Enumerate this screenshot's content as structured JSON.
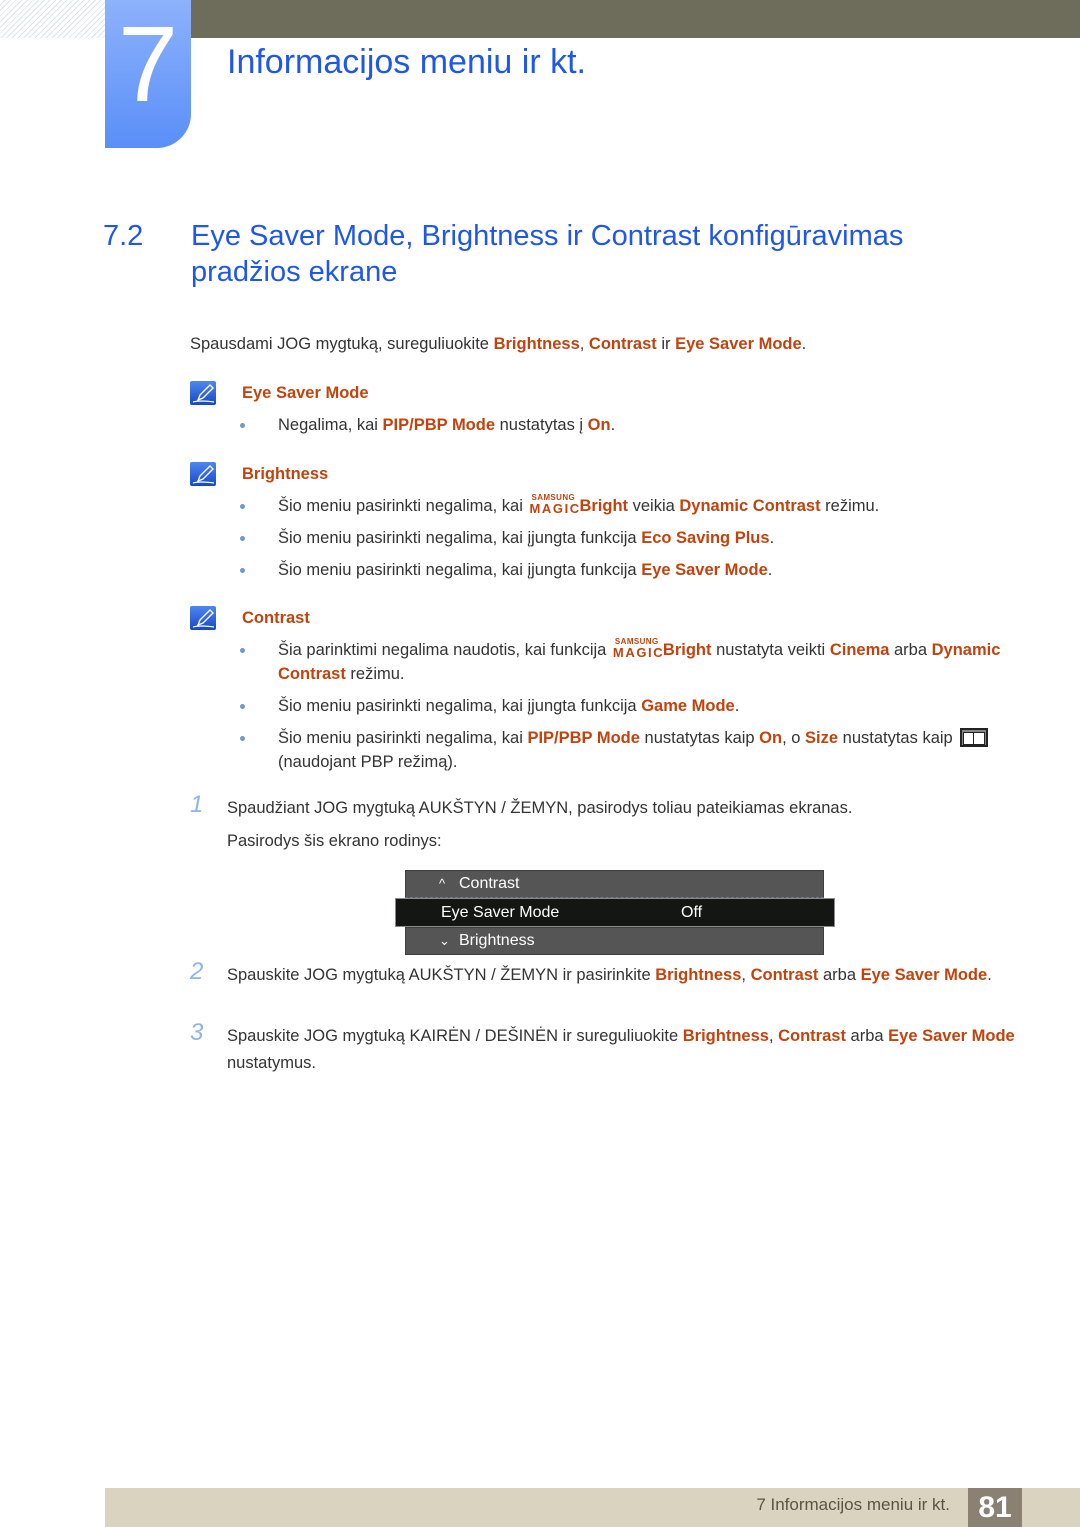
{
  "header": {
    "chapter_number": "7",
    "chapter_title": "Informacijos meniu ir kt."
  },
  "section": {
    "number": "7.2",
    "title": "Eye Saver Mode, Brightness ir Contrast konfigūravimas pradžios ekrane"
  },
  "intro": {
    "t1": "Spausdami JOG mygtuką, sureguliuokite ",
    "h1": "Brightness",
    "t2": ", ",
    "h2": "Contrast",
    "t3": " ir ",
    "h3": "Eye Saver Mode",
    "t4": "."
  },
  "notes": [
    {
      "title": "Eye Saver Mode",
      "bullets": [
        {
          "t1": "Negalima, kai ",
          "h1": "PIP/PBP Mode",
          "t2": " nustatytas į ",
          "h2": "On",
          "t3": "."
        }
      ]
    },
    {
      "title": "Brightness",
      "bullets": [
        {
          "t1": "Šio meniu pasirinkti negalima, kai ",
          "logo_top": "SAMSUNG",
          "logo_bottom": "MAGIC",
          "h1": "Bright",
          "t2": " veikia ",
          "h2": "Dynamic Contrast",
          "t3": " režimu."
        },
        {
          "t1": "Šio meniu pasirinkti negalima, kai įjungta funkcija ",
          "h1": "Eco Saving Plus",
          "t2": "."
        },
        {
          "t1": "Šio meniu pasirinkti negalima, kai įjungta funkcija ",
          "h1": "Eye Saver Mode",
          "t2": "."
        }
      ]
    },
    {
      "title": "Contrast",
      "bullets": [
        {
          "t1": "Šia parinktimi negalima naudotis, kai funkcija ",
          "logo_top": "SAMSUNG",
          "logo_bottom": "MAGIC",
          "h1": "Bright",
          "t2": " nustatyta veikti ",
          "h2": "Cinema",
          "t3": " arba ",
          "h3": "Dynamic Contrast",
          "t4": " režimu."
        },
        {
          "t1": "Šio meniu pasirinkti negalima, kai įjungta funkcija ",
          "h1": "Game Mode",
          "t2": "."
        },
        {
          "t1": "Šio meniu pasirinkti negalima, kai ",
          "h1": "PIP/PBP Mode",
          "t2": " nustatytas kaip ",
          "h2": "On",
          "t3": ", o ",
          "h3": "Size",
          "t4": " nustatytas kaip ",
          "icon": "pbp-split-icon",
          "t5": "(naudojant PBP režimą)."
        }
      ]
    }
  ],
  "steps": [
    {
      "number": "1",
      "t1": "Spaudžiant JOG mygtuką AUKŠTYN / ŽEMYN, pasirodys toliau pateikiamas ekranas.",
      "t2": "Pasirodys šis ekrano rodinys:"
    },
    {
      "number": "2",
      "t1": "Spauskite JOG mygtuką AUKŠTYN / ŽEMYN ir pasirinkite ",
      "h1": "Brightness",
      "t2": ", ",
      "h2": "Contrast",
      "t3": " arba ",
      "h3": "Eye Saver Mode",
      "t4": "."
    },
    {
      "number": "3",
      "t1": "Spauskite JOG mygtuką KAIRĖN / DEŠINĖN ir sureguliuokite ",
      "h1": "Brightness",
      "t2": ", ",
      "h2": "Contrast",
      "t3": " arba ",
      "h3": "Eye Saver Mode",
      "t4": " nustatymus."
    }
  ],
  "osd_menu": {
    "prev_item": {
      "arrow": "^",
      "label": "Contrast"
    },
    "selected_item": {
      "label": "Eye Saver Mode",
      "value": "Off"
    },
    "next_item": {
      "arrow": "⌄",
      "label": "Brightness"
    }
  },
  "footer": {
    "text": "7 Informacijos meniu ir kt.",
    "page_number": "81"
  },
  "colors": {
    "heading_blue": "#1f57e8",
    "highlight_orange": "#c2430e",
    "top_bar": "#6e6c5a",
    "footer_bar": "#dad3bf",
    "page_box": "#8b8173"
  }
}
